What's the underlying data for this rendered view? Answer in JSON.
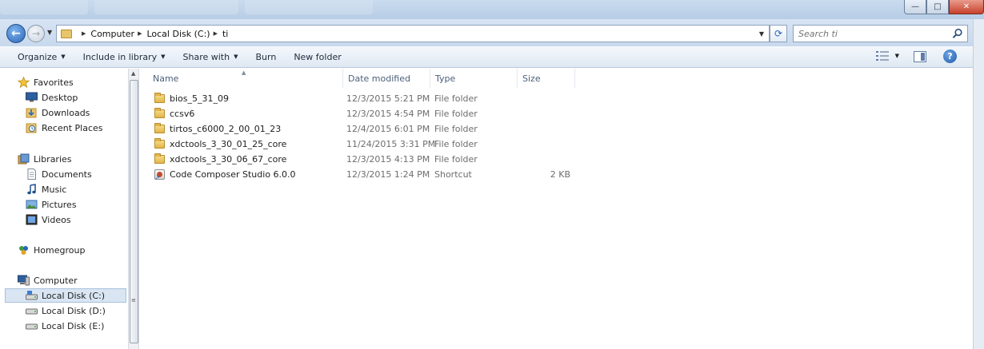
{
  "window": {
    "controls": {
      "minimize": "—",
      "maximize": "□",
      "close": "✕"
    }
  },
  "address": {
    "breadcrumbs": [
      "Computer",
      "Local Disk (C:)",
      "ti"
    ],
    "search_placeholder": "Search ti"
  },
  "toolbar": {
    "organize": "Organize",
    "include_in_library": "Include in library",
    "share_with": "Share with",
    "burn": "Burn",
    "new_folder": "New folder"
  },
  "nav": {
    "favorites": {
      "label": "Favorites",
      "items": [
        "Desktop",
        "Downloads",
        "Recent Places"
      ]
    },
    "libraries": {
      "label": "Libraries",
      "items": [
        "Documents",
        "Music",
        "Pictures",
        "Videos"
      ]
    },
    "homegroup": "Homegroup",
    "computer": {
      "label": "Computer",
      "items": [
        "Local Disk (C:)",
        "Local Disk (D:)",
        "Local Disk (E:)"
      ],
      "selected": "Local Disk (C:)"
    }
  },
  "columns": [
    "Name",
    "Date modified",
    "Type",
    "Size"
  ],
  "files": [
    {
      "name": "bios_5_31_09",
      "date": "12/3/2015 5:21 PM",
      "type": "File folder",
      "size": "",
      "icon": "folder-icon"
    },
    {
      "name": "ccsv6",
      "date": "12/3/2015 4:54 PM",
      "type": "File folder",
      "size": "",
      "icon": "folder-icon"
    },
    {
      "name": "tirtos_c6000_2_00_01_23",
      "date": "12/4/2015 6:01 PM",
      "type": "File folder",
      "size": "",
      "icon": "folder-icon"
    },
    {
      "name": "xdctools_3_30_01_25_core",
      "date": "11/24/2015 3:31 PM",
      "type": "File folder",
      "size": "",
      "icon": "folder-icon"
    },
    {
      "name": "xdctools_3_30_06_67_core",
      "date": "12/3/2015 4:13 PM",
      "type": "File folder",
      "size": "",
      "icon": "folder-icon"
    },
    {
      "name": "Code Composer Studio 6.0.0",
      "date": "12/3/2015 1:24 PM",
      "type": "Shortcut",
      "size": "2 KB",
      "icon": "shortcut-icon"
    }
  ]
}
